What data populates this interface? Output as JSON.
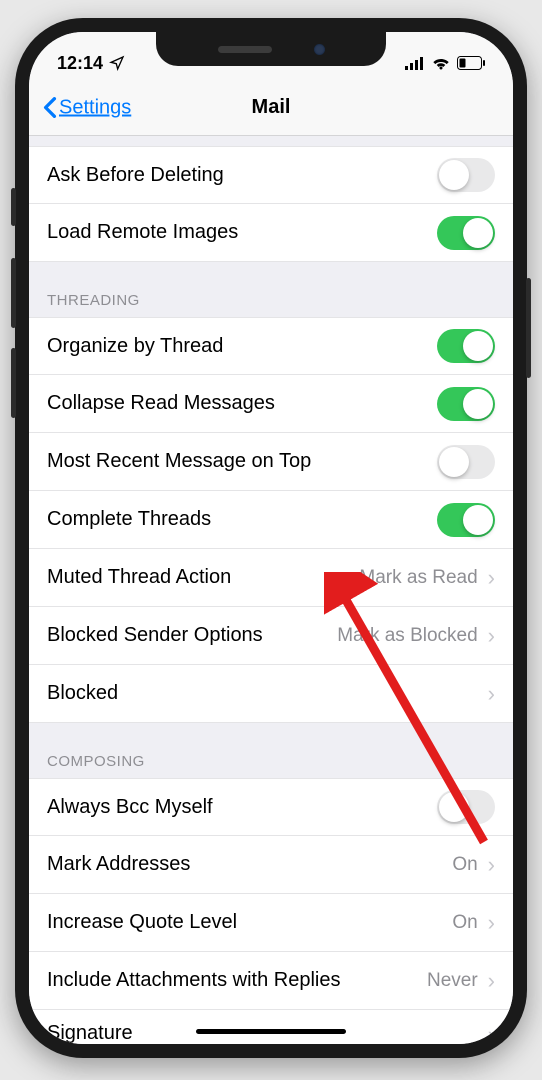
{
  "statusBar": {
    "time": "12:14"
  },
  "nav": {
    "back": "Settings",
    "title": "Mail"
  },
  "section1": {
    "askBeforeDeleting": {
      "label": "Ask Before Deleting",
      "on": false
    },
    "loadRemoteImages": {
      "label": "Load Remote Images",
      "on": true
    }
  },
  "threading": {
    "header": "THREADING",
    "organizeByThread": {
      "label": "Organize by Thread",
      "on": true
    },
    "collapseReadMessages": {
      "label": "Collapse Read Messages",
      "on": true
    },
    "mostRecentOnTop": {
      "label": "Most Recent Message on Top",
      "on": false
    },
    "completeThreads": {
      "label": "Complete Threads",
      "on": true
    },
    "mutedThreadAction": {
      "label": "Muted Thread Action",
      "value": "Mark as Read"
    },
    "blockedSenderOptions": {
      "label": "Blocked Sender Options",
      "value": "Mark as Blocked"
    },
    "blocked": {
      "label": "Blocked"
    }
  },
  "composing": {
    "header": "COMPOSING",
    "alwaysBccMyself": {
      "label": "Always Bcc Myself",
      "on": false
    },
    "markAddresses": {
      "label": "Mark Addresses",
      "value": "On"
    },
    "increaseQuoteLevel": {
      "label": "Increase Quote Level",
      "value": "On"
    },
    "includeAttachments": {
      "label": "Include Attachments with Replies",
      "value": "Never"
    },
    "signature": {
      "label": "Signature"
    }
  }
}
